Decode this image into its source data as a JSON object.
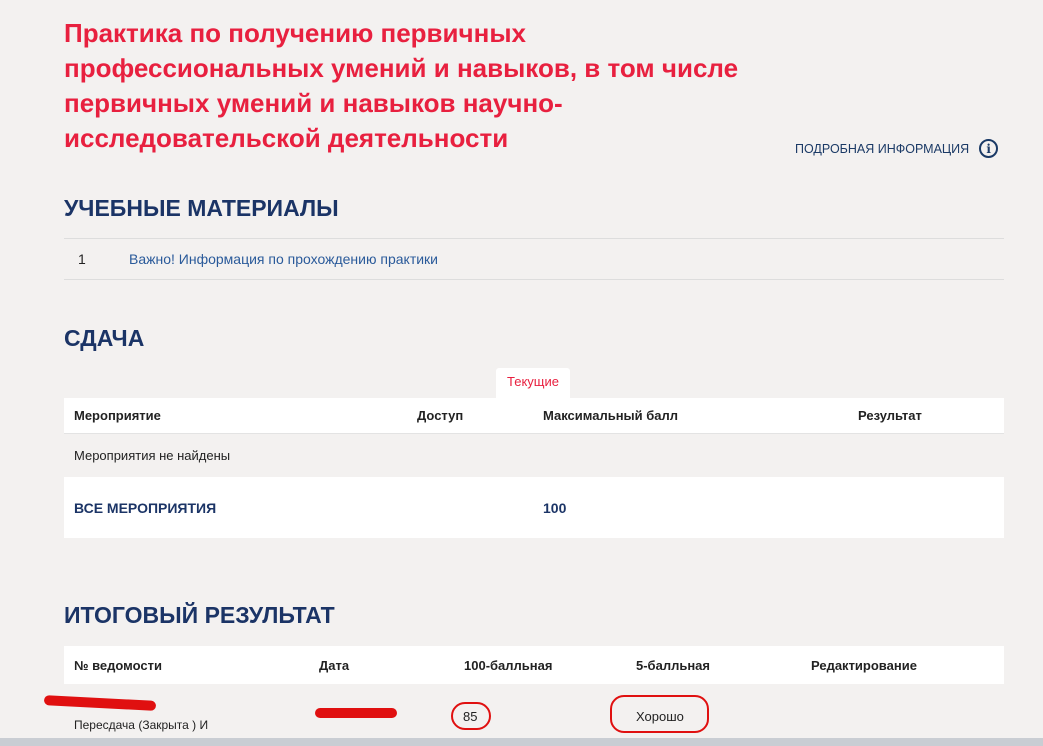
{
  "title": "Практика по получению первичных профессиональных умений и навыков, в том числе первичных умений и навыков научно-исследовательской деятельности",
  "more_info": "ПОДРОБНАЯ ИНФОРМАЦИЯ",
  "info_icon": "i",
  "materials": {
    "heading": "УЧЕБНЫЕ МАТЕРИАЛЫ",
    "items": [
      {
        "n": "1",
        "label": "Важно! Информация по прохождению практики"
      }
    ]
  },
  "submission": {
    "heading": "СДАЧА",
    "tab": "Текущие",
    "columns": [
      "Мероприятие",
      "Доступ",
      "Максимальный балл",
      "Результат"
    ],
    "empty": "Мероприятия не найдены",
    "total_label": "ВСЕ МЕРОПРИЯТИЯ",
    "total_max": "100"
  },
  "final": {
    "heading": "ИТОГОВЫЙ РЕЗУЛЬТАТ",
    "columns": [
      "№ ведомости",
      "Дата",
      "100-балльная",
      "5-балльная",
      "Редактирование"
    ],
    "row": {
      "type": "Пересдача (Закрыта ) И",
      "score100": "85",
      "score5": "Хорошо"
    }
  }
}
